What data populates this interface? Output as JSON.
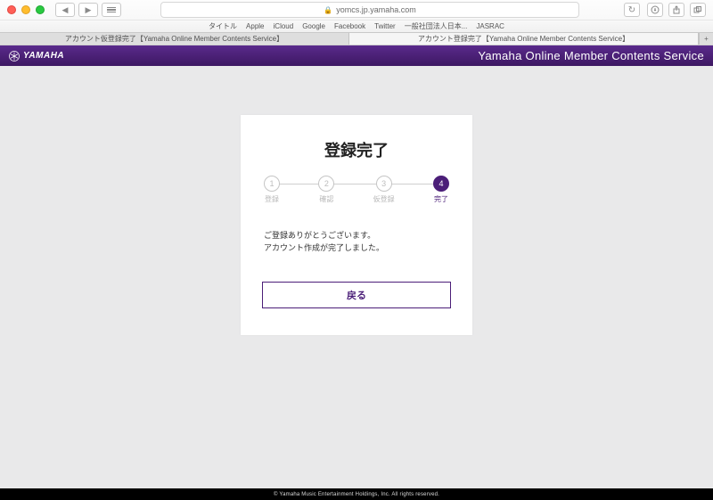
{
  "browser": {
    "url_host": "yomcs.jp.yamaha.com",
    "bookmarks": [
      "タイトル",
      "Apple",
      "iCloud",
      "Google",
      "Facebook",
      "Twitter",
      "一般社団法人日本...",
      "JASRAC"
    ],
    "tabs": [
      {
        "label": "アカウント仮登録完了【Yamaha Online Member Contents Service】",
        "active": false
      },
      {
        "label": "アカウント登録完了【Yamaha Online Member Contents Service】",
        "active": true
      }
    ]
  },
  "header": {
    "logo_text": "YAMAHA",
    "service_text": "Yamaha Online Member Contents Service"
  },
  "card": {
    "title": "登録完了",
    "steps": [
      {
        "num": "1",
        "label": "登録",
        "active": false
      },
      {
        "num": "2",
        "label": "確認",
        "active": false
      },
      {
        "num": "3",
        "label": "仮登録",
        "active": false
      },
      {
        "num": "4",
        "label": "完了",
        "active": true
      }
    ],
    "message_line1": "ご登録ありがとうございます。",
    "message_line2": "アカウント作成が完了しました。",
    "back_button": "戻る"
  },
  "footer": {
    "copyright": "© Yamaha Music Entertainment Holdings, Inc. All rights reserved."
  }
}
